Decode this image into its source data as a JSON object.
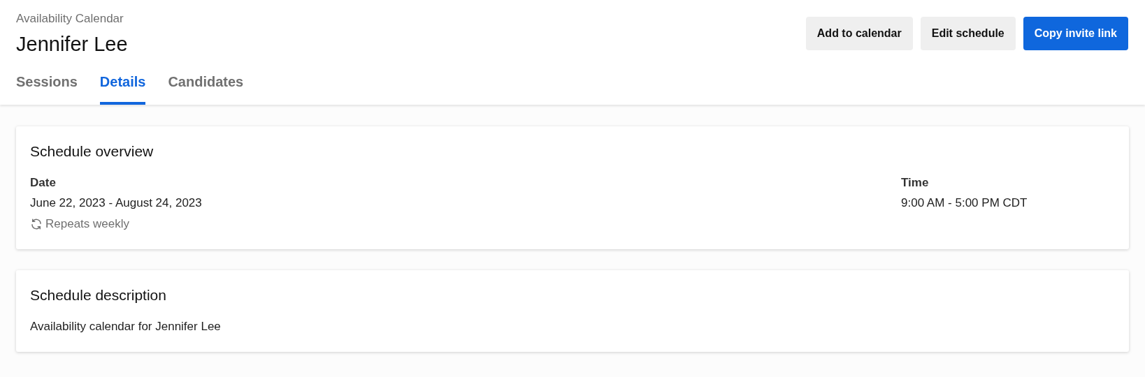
{
  "header": {
    "subtitle": "Availability Calendar",
    "title": "Jennifer Lee"
  },
  "actions": [
    {
      "label": "Add to calendar",
      "kind": "secondary"
    },
    {
      "label": "Edit schedule",
      "kind": "secondary"
    },
    {
      "label": "Copy invite link",
      "kind": "primary"
    }
  ],
  "tabs": [
    {
      "label": "Sessions",
      "selected": false
    },
    {
      "label": "Details",
      "selected": true
    },
    {
      "label": "Candidates",
      "selected": false
    }
  ],
  "overview": {
    "title": "Schedule overview",
    "date_label": "Date",
    "date_value": "June 22, 2023 - August 24, 2023",
    "repeat": "Repeats weekly",
    "time_label": "Time",
    "time_value": "9:00 AM - 5:00 PM CDT"
  },
  "description": {
    "title": "Schedule description",
    "text": "Availability calendar for Jennifer Lee"
  }
}
